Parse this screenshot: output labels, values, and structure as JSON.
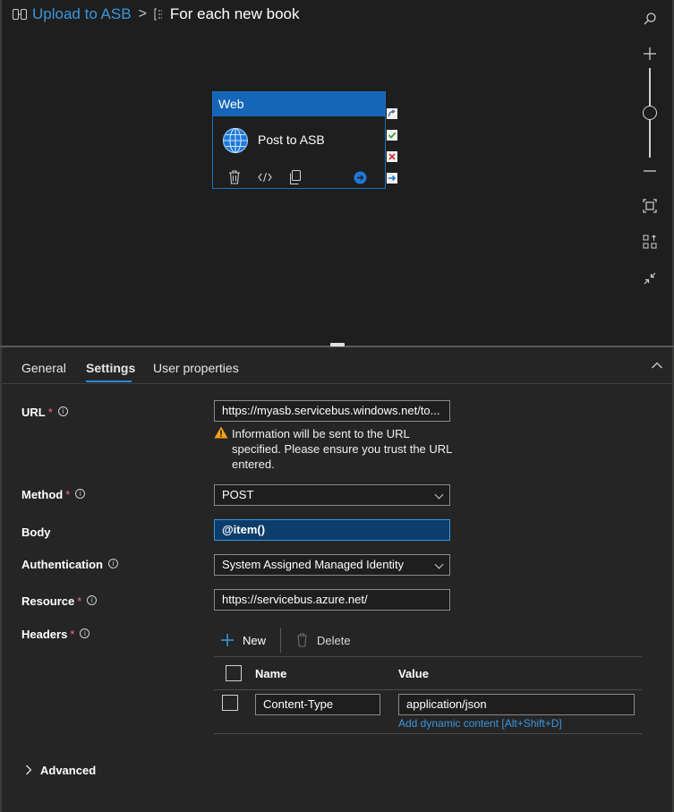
{
  "breadcrumb": {
    "pipeline": "Upload to ASB",
    "separator": ">",
    "current": "For each new book"
  },
  "zoom_controls": {
    "slider_level": 0.5,
    "icons": [
      "search-icon",
      "zoom-in-icon",
      "zoom-slider",
      "zoom-out-icon",
      "fit-to-screen-icon",
      "auto-align-icon",
      "collapse-icon"
    ]
  },
  "activity": {
    "type": "Web",
    "name": "Post to ASB",
    "icons": [
      "globe-icon",
      "delete-icon",
      "code-icon",
      "copy-icon",
      "go-icon"
    ],
    "status_icons": [
      "skipped-icon",
      "success-icon",
      "failure-icon",
      "completion-icon"
    ],
    "colors": {
      "header": "#1565b8",
      "success": "#3c9c32",
      "failure": "#d13438"
    }
  },
  "tabs": [
    "General",
    "Settings",
    "User properties"
  ],
  "active_tab": "Settings",
  "settings": {
    "url": {
      "label": "URL",
      "required": "*",
      "value": "https://myasb.servicebus.windows.net/to...",
      "warning": "Information will be sent to the URL specified. Please ensure you trust the URL entered."
    },
    "method": {
      "label": "Method",
      "required": "*",
      "value": "POST"
    },
    "body": {
      "label": "Body",
      "value": "@item()"
    },
    "authentication": {
      "label": "Authentication",
      "value": "System Assigned Managed Identity"
    },
    "resource": {
      "label": "Resource",
      "required": "*",
      "value": "https://servicebus.azure.net/"
    },
    "headers": {
      "label": "Headers",
      "required": "*",
      "new_label": "New",
      "delete_label": "Delete",
      "columns": [
        "Name",
        "Value"
      ],
      "rows": [
        {
          "name": "Content-Type",
          "value": "application/json",
          "dynamic_link": "Add dynamic content [Alt+Shift+D]"
        }
      ]
    },
    "advanced_label": "Advanced"
  },
  "accent_colors": {
    "link": "#3a96dd",
    "body_highlight": "#0c3d6b",
    "body_border": "#3a96dd",
    "warning": "#f7a21b"
  }
}
